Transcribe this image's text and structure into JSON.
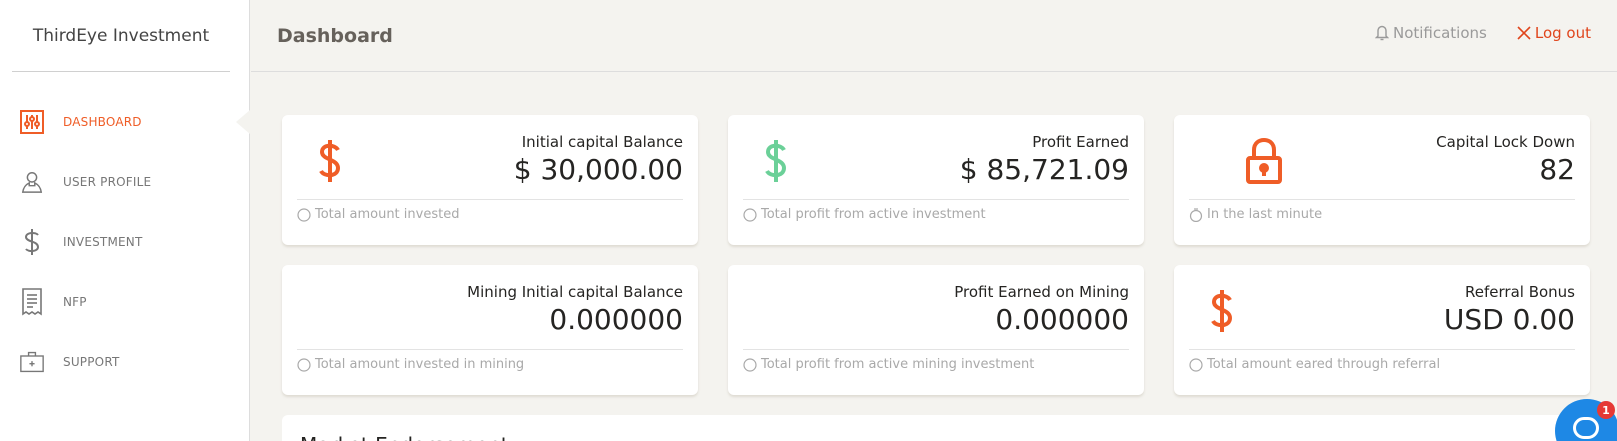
{
  "brand": "ThirdEye Investment",
  "nav": [
    {
      "label": "DASHBOARD",
      "icon": "dashboard-icon",
      "active": true
    },
    {
      "label": "USER PROFILE",
      "icon": "user-icon",
      "active": false
    },
    {
      "label": "INVESTMENT",
      "icon": "dollar-icon",
      "active": false
    },
    {
      "label": "NFP",
      "icon": "receipt-icon",
      "active": false
    },
    {
      "label": "SUPPORT",
      "icon": "briefcase-icon",
      "active": false
    }
  ],
  "header": {
    "title": "Dashboard",
    "notifications_label": "Notifications",
    "logout_label": "Log out"
  },
  "cards": [
    {
      "label": "Initial capital Balance",
      "value": "$ 30,000.00",
      "footer": "Total amount invested",
      "icon": "dollar-icon",
      "icon_color": "#ef5d27"
    },
    {
      "label": "Profit Earned",
      "value": "$ 85,721.09",
      "footer": "Total profit from active investment",
      "icon": "dollar-icon",
      "icon_color": "#6bd098"
    },
    {
      "label": "Capital Lock Down",
      "value": "82",
      "footer": "In the last minute",
      "icon": "lock-icon",
      "icon_color": "#ef5d27"
    },
    {
      "label": "Mining Initial capital Balance",
      "value": "0.000000",
      "footer": "Total amount invested in mining",
      "icon": "",
      "icon_color": ""
    },
    {
      "label": "Profit Earned on Mining",
      "value": "0.000000",
      "footer": "Total profit from active mining investment",
      "icon": "",
      "icon_color": ""
    },
    {
      "label": "Referral Bonus",
      "value": "USD 0.00",
      "footer": "Total amount eared through referral",
      "icon": "dollar-icon",
      "icon_color": "#ef5d27"
    }
  ],
  "bottom_panel_title": "Market Endorsement",
  "chat": {
    "badge": "1"
  },
  "colors": {
    "accent": "#ef5d27",
    "success": "#6bd098",
    "logout": "#e0451c",
    "chat": "#1e88e5"
  }
}
